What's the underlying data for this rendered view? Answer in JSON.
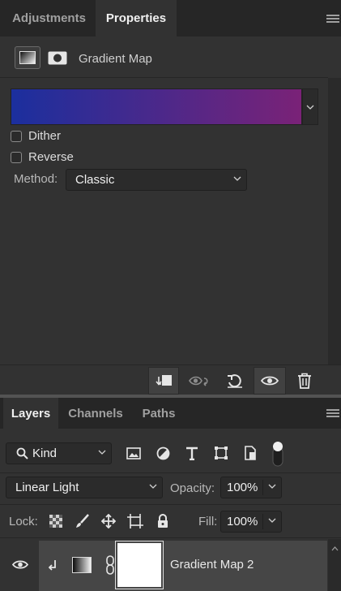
{
  "properties_panel": {
    "tabs": [
      {
        "label": "Adjustments",
        "active": false
      },
      {
        "label": "Properties",
        "active": true
      }
    ],
    "title": "Gradient Map",
    "gradient": {
      "start_color": "#1b2f9e",
      "end_color": "#7a2277"
    },
    "dither_label": "Dither",
    "dither_checked": false,
    "reverse_label": "Reverse",
    "reverse_checked": false,
    "method_label": "Method:",
    "method_value": "Classic",
    "footer_icons": [
      "clip-to-layer-icon",
      "view-previous-state-icon",
      "reset-icon",
      "visibility-icon",
      "trash-icon"
    ]
  },
  "layers_panel": {
    "tabs": [
      {
        "label": "Layers",
        "active": true
      },
      {
        "label": "Channels",
        "active": false
      },
      {
        "label": "Paths",
        "active": false
      }
    ],
    "filter": {
      "kind_label": "Kind"
    },
    "blend_mode": "Linear Light",
    "opacity_label": "Opacity:",
    "opacity_value": "100%",
    "lock_label": "Lock:",
    "fill_label": "Fill:",
    "fill_value": "100%",
    "layers": [
      {
        "name": "Gradient Map 2",
        "visible": true,
        "clipped": true
      }
    ]
  },
  "colors": {
    "panel_bg": "#323232",
    "tab_bar_bg": "#262626",
    "accent_white": "#ffffff"
  }
}
